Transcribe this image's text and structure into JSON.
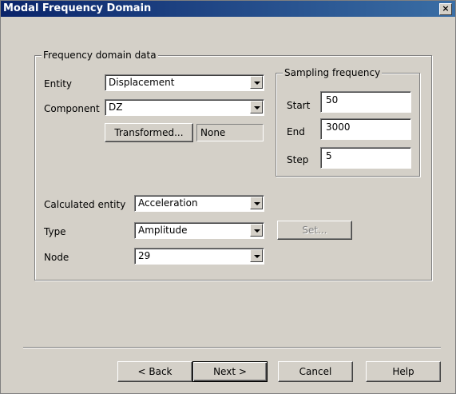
{
  "window": {
    "title": "Modal Frequency Domain",
    "close_glyph": "×"
  },
  "frequency_group": {
    "legend": "Frequency domain data",
    "entity_label": "Entity",
    "entity_value": "Displacement",
    "component_label": "Component",
    "component_value": "DZ",
    "transformed_label": "Transformed...",
    "transformed_value": "None",
    "calculated_entity_label": "Calculated entity",
    "calculated_entity_value": "Acceleration",
    "type_label": "Type",
    "type_value": "Amplitude",
    "node_label": "Node",
    "node_value": "29",
    "set_label": "Set..."
  },
  "sampling_group": {
    "legend": "Sampling frequency",
    "start_label": "Start",
    "start_value": "50",
    "end_label": "End",
    "end_value": "3000",
    "step_label": "Step",
    "step_value": "5"
  },
  "footer": {
    "back_label": "< Back",
    "next_label": "Next >",
    "cancel_label": "Cancel",
    "help_label": "Help"
  },
  "colors": {
    "title_gradient_start": "#0a246a",
    "title_gradient_end": "#3a6ea5",
    "dialog_bg": "#d4d0c8"
  },
  "icons": {
    "close": "close-icon",
    "dropdown": "dropdown-arrow-icon"
  }
}
